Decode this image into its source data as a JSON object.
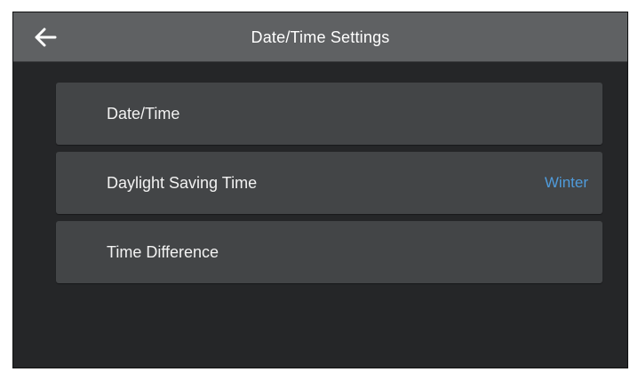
{
  "header": {
    "title": "Date/Time Settings",
    "back_icon": "arrow-left-icon"
  },
  "menu": {
    "items": [
      {
        "label": "Date/Time",
        "value": ""
      },
      {
        "label": "Daylight Saving Time",
        "value": "Winter"
      },
      {
        "label": "Time Difference",
        "value": ""
      }
    ]
  },
  "colors": {
    "header_bg": "#5f6163",
    "screen_bg": "#252628",
    "item_bg": "#434547",
    "accent_value": "#4f9bdb"
  }
}
